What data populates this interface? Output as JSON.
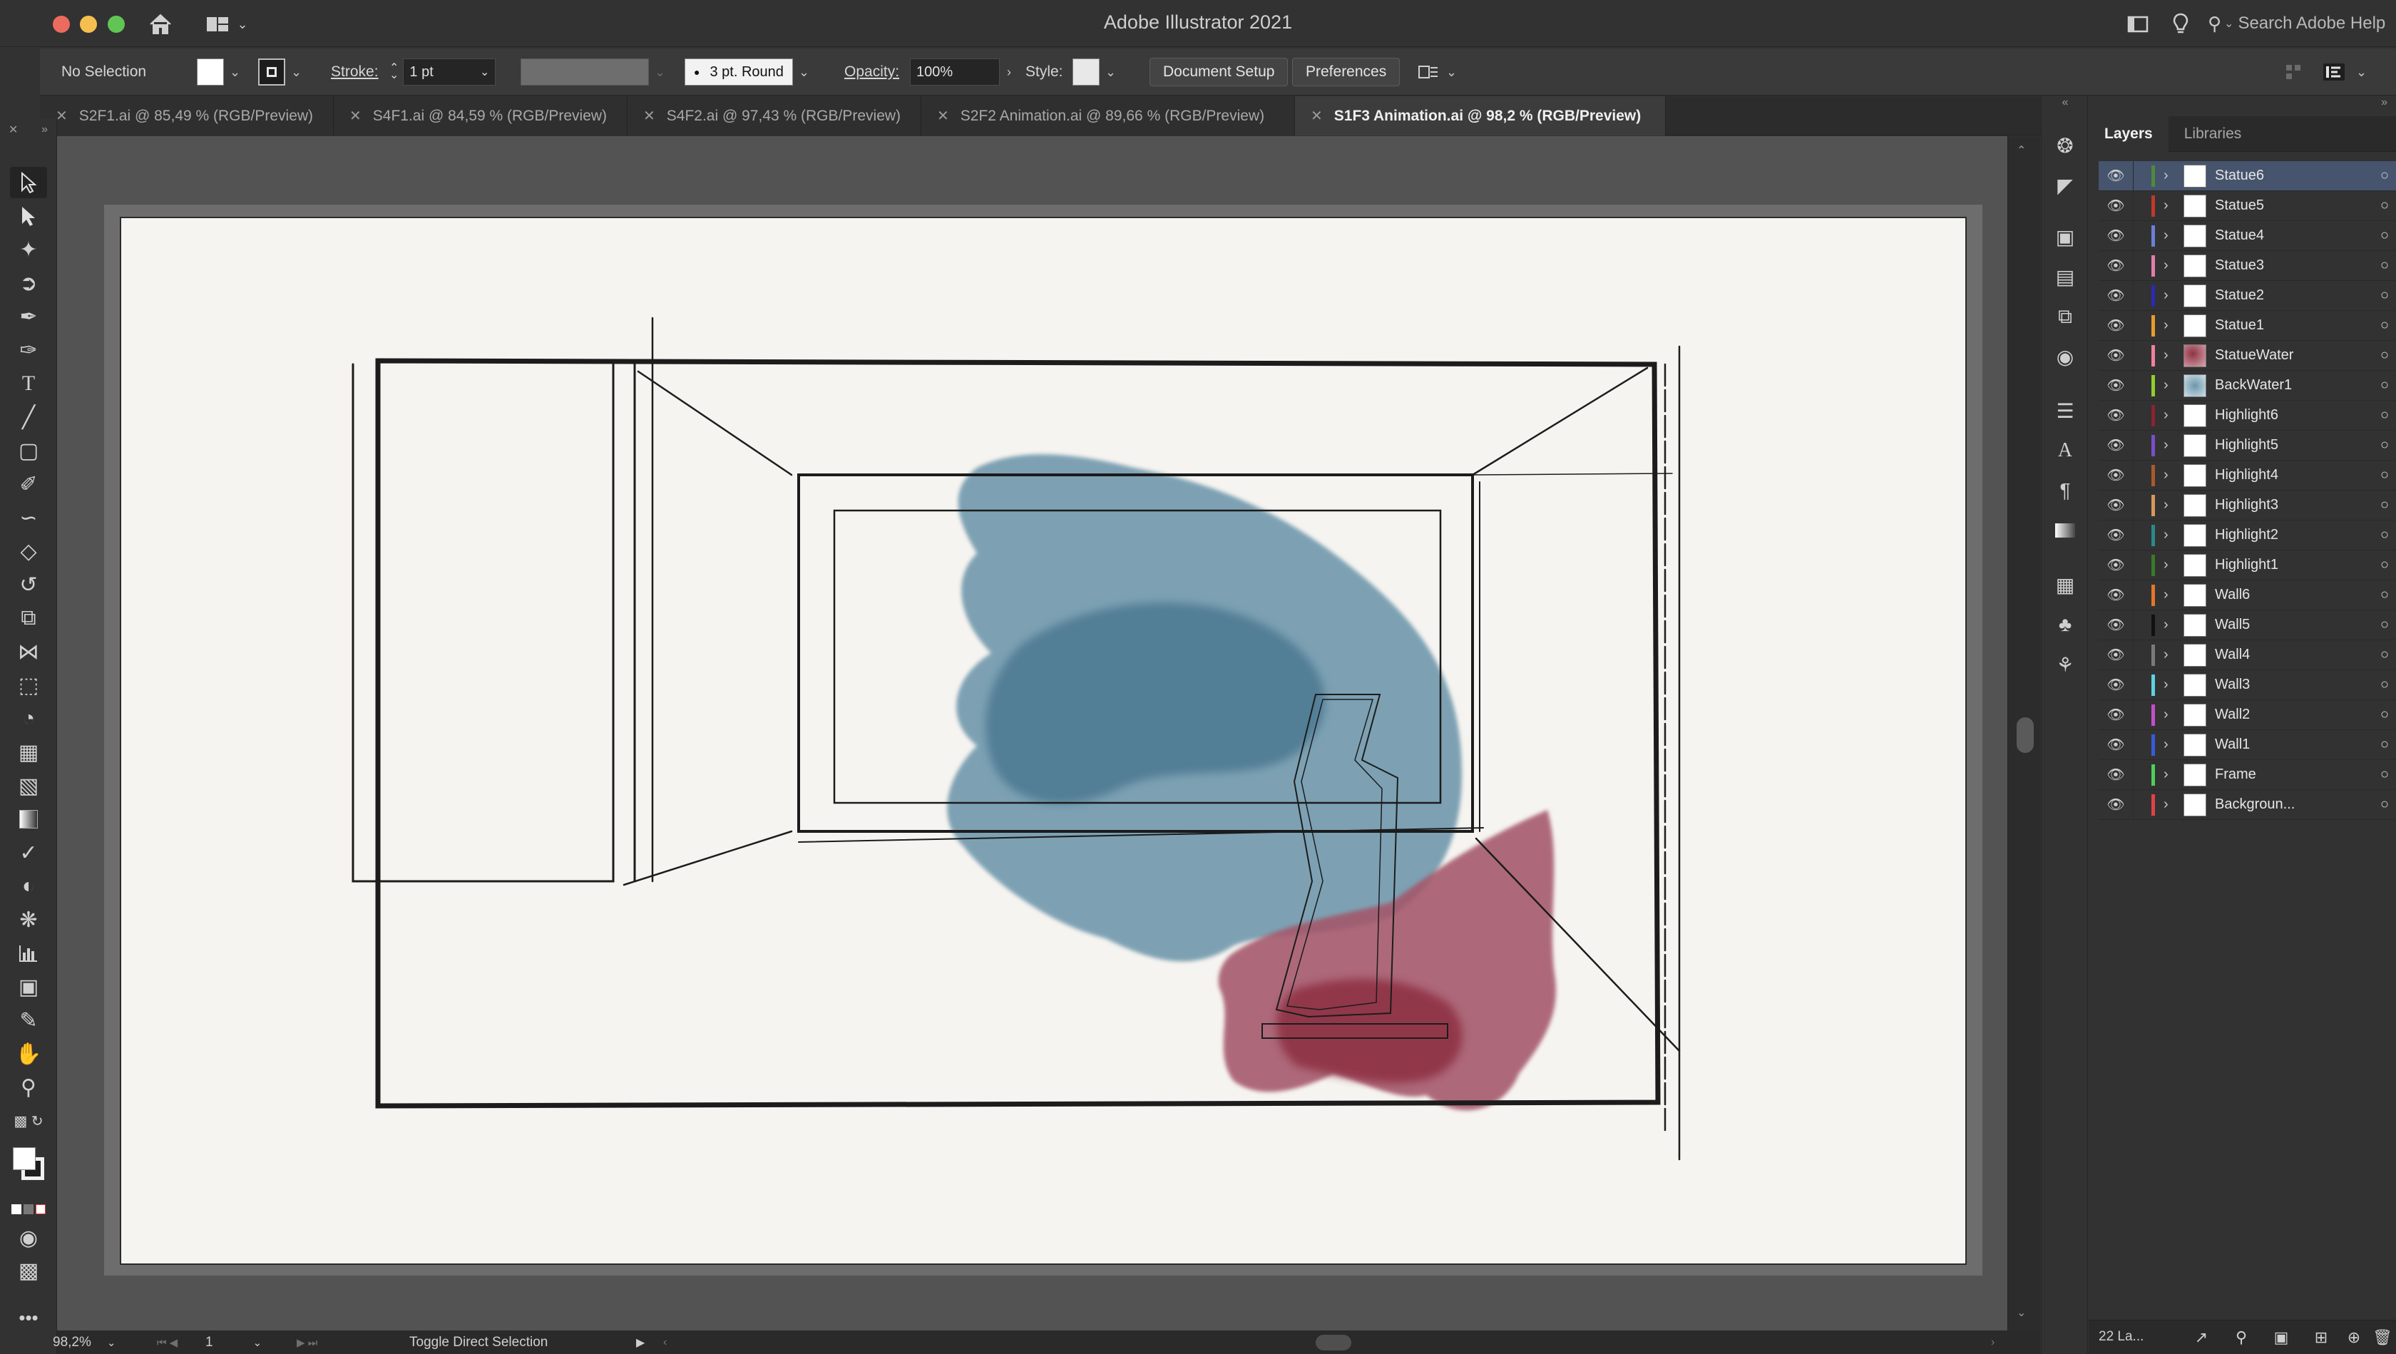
{
  "app": {
    "title": "Adobe Illustrator 2021",
    "search_placeholder": "Search Adobe Help"
  },
  "control_bar": {
    "selection_label": "No Selection",
    "stroke_label": "Stroke:",
    "stroke_weight": "1 pt",
    "brush_label": "3 pt. Round",
    "opacity_label": "Opacity:",
    "opacity_value": "100%",
    "style_label": "Style:",
    "document_setup": "Document Setup",
    "preferences": "Preferences"
  },
  "tabs": [
    {
      "label": "S2F1.ai @ 85,49 % (RGB/Preview)",
      "active": false
    },
    {
      "label": "S4F1.ai @ 84,59 % (RGB/Preview)",
      "active": false
    },
    {
      "label": "S4F2.ai @ 97,43 % (RGB/Preview)",
      "active": false
    },
    {
      "label": "S2F2 Animation.ai @ 89,66 % (RGB/Preview)",
      "active": false
    },
    {
      "label": "S1F3 Animation.ai @ 98,2 % (RGB/Preview)",
      "active": true
    }
  ],
  "panel": {
    "tabs": [
      "Layers",
      "Libraries"
    ],
    "layer_count": "22 La...",
    "layers": [
      {
        "name": "Statue6",
        "color": "#4f8a3a",
        "selected": true
      },
      {
        "name": "Statue5",
        "color": "#c0392b",
        "selected": false
      },
      {
        "name": "Statue4",
        "color": "#6b7fd7",
        "selected": false
      },
      {
        "name": "Statue3",
        "color": "#e17ea9",
        "selected": false
      },
      {
        "name": "Statue2",
        "color": "#2a2ab8",
        "selected": false
      },
      {
        "name": "Statue1",
        "color": "#e89b2e",
        "selected": false
      },
      {
        "name": "StatueWater",
        "color": "#f07fa0",
        "selected": false
      },
      {
        "name": "BackWater1",
        "color": "#8fcf2e",
        "selected": false
      },
      {
        "name": "Highlight6",
        "color": "#8a2330",
        "selected": false
      },
      {
        "name": "Highlight5",
        "color": "#7a4ec9",
        "selected": false
      },
      {
        "name": "Highlight4",
        "color": "#a85a2a",
        "selected": false
      },
      {
        "name": "Highlight3",
        "color": "#d9965b",
        "selected": false
      },
      {
        "name": "Highlight2",
        "color": "#2a8a8a",
        "selected": false
      },
      {
        "name": "Highlight1",
        "color": "#3a7a2a",
        "selected": false
      },
      {
        "name": "Wall6",
        "color": "#e5742a",
        "selected": false
      },
      {
        "name": "Wall5",
        "color": "#111111",
        "selected": false
      },
      {
        "name": "Wall4",
        "color": "#7a7a7a",
        "selected": false
      },
      {
        "name": "Wall3",
        "color": "#5fd3e0",
        "selected": false
      },
      {
        "name": "Wall2",
        "color": "#c44ec9",
        "selected": false
      },
      {
        "name": "Wall1",
        "color": "#3a5ad7",
        "selected": false
      },
      {
        "name": "Frame",
        "color": "#4fcf5a",
        "selected": false
      },
      {
        "name": "Backgroun...",
        "color": "#e0424a",
        "selected": false
      }
    ]
  },
  "status": {
    "zoom": "98,2%",
    "artboard": "1",
    "tool_hint": "Toggle Direct Selection"
  },
  "palette": {
    "watercolor_blue": "#6d96ab",
    "watercolor_red": "#8f3344",
    "selection_blue": "#46546e"
  }
}
